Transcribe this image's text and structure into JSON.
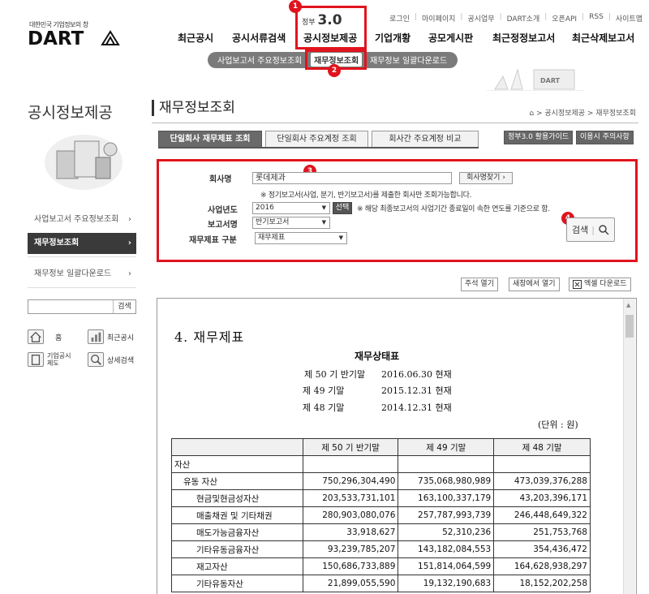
{
  "header": {
    "slogan": "대한민국 기업정보의 창",
    "logo_text": "DART",
    "gov_label": "정부",
    "gov_version": "3.0",
    "util_links": [
      "로그인",
      "마이페이지",
      "공시업무",
      "DART소개",
      "오픈API",
      "RSS",
      "사이트맵"
    ],
    "nav": [
      "최근공시",
      "공시서류검색",
      "공시정보제공",
      "기업개황",
      "공모게시판",
      "최근정정보고서",
      "최근삭제보고서"
    ],
    "subnav": [
      "사업보고서 주요정보조회",
      "재무정보조회",
      "재무정보 일괄다운로드"
    ],
    "deco_text": "DART"
  },
  "badges": [
    "1",
    "2",
    "3",
    "4"
  ],
  "sidebar": {
    "title": "공시정보제공",
    "items": [
      "사업보고서 주요정보조회",
      "재무정보조회",
      "재무정보 일괄다운로드"
    ],
    "arrow": "›",
    "search_btn": "검색",
    "quick": [
      "홈",
      "최근공시",
      "기업공시\n제도",
      "상세검색"
    ]
  },
  "main": {
    "title": "재무정보조회",
    "breadcrumb": "⌂ > 공시정보제공 > 재무정보조회",
    "tabs": [
      "단일회사 재무제표 조회",
      "단일회사 주요계정 조회",
      "회사간 주요계정 비교"
    ],
    "guide_buttons": [
      "정부3.0 활용가이드",
      "이용시 주의사항"
    ],
    "form": {
      "company_label": "회사명",
      "company_value": "롯데제과",
      "company_find_btn": "회사명찾기 ›",
      "company_note": "※ 정기보고서(사업, 분기, 반기보고서)를 제출한 회사만 조회가능합니다.",
      "year_label": "사업년도",
      "year_value": "2016",
      "year_select_btn": "선택",
      "year_note": "※ 해당 최종보고서의 사업기간 종료일이 속한 연도를 기준으로 함.",
      "report_label": "보고서명",
      "report_value": "반기보고서",
      "fs_label": "재무제표 구분",
      "fs_value": "재무제표",
      "search_btn": "검색"
    },
    "actions": [
      "주석 열기",
      "새창에서 열기",
      "엑셀 다운로드"
    ]
  },
  "document": {
    "heading": "4. 재무제표",
    "title": "재무상태표",
    "periods": [
      {
        "label": "제 50 기 반기말",
        "date": "2016.06.30 현재"
      },
      {
        "label": "제 49 기말",
        "date": "2015.12.31 현재"
      },
      {
        "label": "제 48 기말",
        "date": "2014.12.31 현재"
      }
    ],
    "unit": "(단위 : 원)",
    "columns": [
      "",
      "제 50 기 반기말",
      "제 49 기말",
      "제 48 기말"
    ],
    "rows": [
      {
        "name": "자산",
        "indent": 0,
        "v": [
          "",
          "",
          ""
        ]
      },
      {
        "name": "유동 자산",
        "indent": 1,
        "v": [
          "750,296,304,490",
          "735,068,980,989",
          "473,039,376,288"
        ]
      },
      {
        "name": "현금및현금성자산",
        "indent": 2,
        "v": [
          "203,533,731,101",
          "163,100,337,179",
          "43,203,396,171"
        ]
      },
      {
        "name": "매출채권 및 기타채권",
        "indent": 2,
        "v": [
          "280,903,080,076",
          "257,787,993,739",
          "246,448,649,322"
        ]
      },
      {
        "name": "매도가능금융자산",
        "indent": 2,
        "v": [
          "33,918,627",
          "52,310,236",
          "251,753,768"
        ]
      },
      {
        "name": "기타유동금융자산",
        "indent": 2,
        "v": [
          "93,239,785,207",
          "143,182,084,553",
          "354,436,472"
        ]
      },
      {
        "name": "재고자산",
        "indent": 2,
        "v": [
          "150,686,733,889",
          "151,814,064,599",
          "164,628,938,297"
        ]
      },
      {
        "name": "기타유동자산",
        "indent": 2,
        "v": [
          "21,899,055,590",
          "19,132,190,683",
          "18,152,202,258"
        ]
      }
    ]
  },
  "colors": {
    "highlight": "#e0141e",
    "active_tab": "#6a6a6a",
    "sidebar_active": "#3a3a3a"
  }
}
